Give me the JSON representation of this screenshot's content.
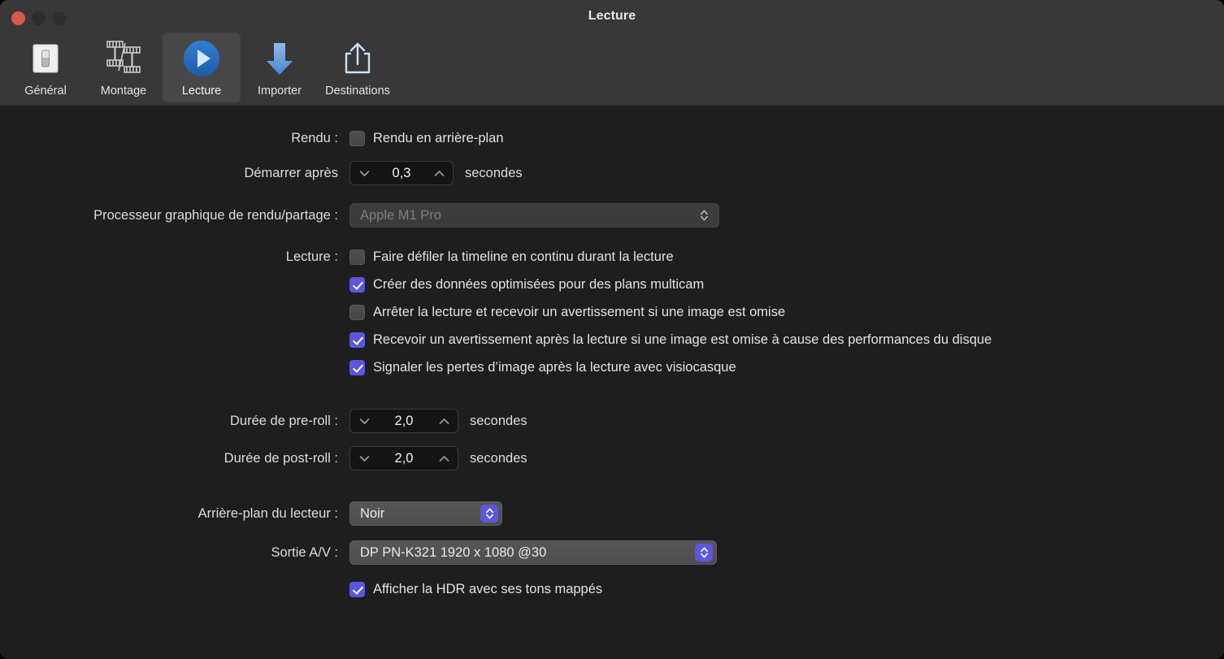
{
  "window": {
    "title": "Lecture",
    "traffic_lights": [
      "close",
      "minimize",
      "zoom"
    ],
    "accent_color": "#5b57e0",
    "titlebar_bg": "#383838",
    "content_bg": "#1e1e1e"
  },
  "toolbar": {
    "items": [
      {
        "id": "general",
        "label": "Général",
        "icon": "switch-icon",
        "selected": false
      },
      {
        "id": "montage",
        "label": "Montage",
        "icon": "film-strips-icon",
        "selected": false
      },
      {
        "id": "lecture",
        "label": "Lecture",
        "icon": "play-circle-icon",
        "selected": true
      },
      {
        "id": "importer",
        "label": "Importer",
        "icon": "down-arrow-icon",
        "selected": false
      },
      {
        "id": "destinations",
        "label": "Destinations",
        "icon": "share-icon",
        "selected": false
      }
    ]
  },
  "settings": {
    "rendu": {
      "label": "Rendu :",
      "background_render": {
        "label": "Rendu en arrière-plan",
        "checked": false
      },
      "delay": {
        "label": "Démarrer après",
        "value": "0,3",
        "unit": "secondes"
      }
    },
    "gpu": {
      "label": "Processeur graphique de rendu/partage :",
      "value": "Apple M1 Pro",
      "disabled": true
    },
    "lecture": {
      "label": "Lecture :",
      "options": [
        {
          "label": "Faire défiler la timeline en continu durant la lecture",
          "checked": false
        },
        {
          "label": "Créer des données optimisées pour des plans multicam",
          "checked": true
        },
        {
          "label": "Arrêter la lecture et recevoir un avertissement si une image est omise",
          "checked": false
        },
        {
          "label": "Recevoir un avertissement après la lecture si une image est omise à cause des performances du disque",
          "checked": true
        },
        {
          "label": "Signaler les pertes d’image après la lecture avec visiocasque",
          "checked": true
        }
      ]
    },
    "preroll": {
      "label": "Durée de pre-roll :",
      "value": "2,0",
      "unit": "secondes"
    },
    "postroll": {
      "label": "Durée de post-roll :",
      "value": "2,0",
      "unit": "secondes"
    },
    "player_background": {
      "label": "Arrière-plan du lecteur :",
      "value": "Noir"
    },
    "av_output": {
      "label": "Sortie A/V :",
      "value": "DP PN-K321 1920 x 1080 @30"
    },
    "hdr": {
      "label": "Afficher la HDR avec ses tons mappés",
      "checked": true
    }
  }
}
